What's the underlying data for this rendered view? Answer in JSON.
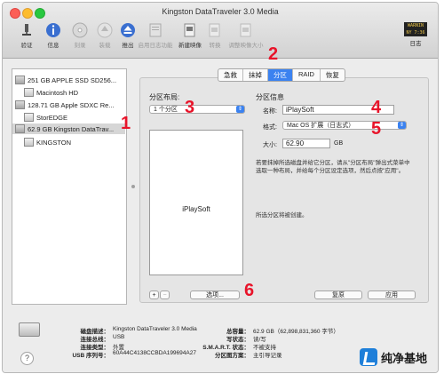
{
  "window": {
    "title": "Kingston DataTraveler 3.0 Media"
  },
  "toolbar": {
    "items": [
      {
        "label": "验证",
        "icon": "microscope-icon",
        "enabled": true
      },
      {
        "label": "信息",
        "icon": "info-icon",
        "enabled": true
      },
      {
        "label": "刻录",
        "icon": "burn-icon",
        "enabled": false
      },
      {
        "label": "装载",
        "icon": "mount-icon",
        "enabled": false
      },
      {
        "label": "推出",
        "icon": "eject-icon",
        "enabled": true
      },
      {
        "label": "启用日志功能",
        "icon": "journal-icon",
        "enabled": false
      },
      {
        "label": "新建映像",
        "icon": "new-image-icon",
        "enabled": true
      },
      {
        "label": "转换",
        "icon": "convert-icon",
        "enabled": false
      },
      {
        "label": "调整映像大小",
        "icon": "resize-image-icon",
        "enabled": false
      }
    ],
    "log": {
      "label": "日志",
      "icon_text": "WARNIN\nNY 7:36"
    }
  },
  "sidebar": {
    "items": [
      {
        "label": "251 GB APPLE SSD SD256...",
        "kind": "disk"
      },
      {
        "label": "Macintosh HD",
        "kind": "volume"
      },
      {
        "label": "128.71 GB Apple SDXC Re...",
        "kind": "disk"
      },
      {
        "label": "StorEDGE",
        "kind": "volume"
      },
      {
        "label": "62.9 GB Kingston DataTrav...",
        "kind": "disk",
        "selected": true
      },
      {
        "label": "KINGSTON",
        "kind": "volume"
      }
    ]
  },
  "tabs": [
    {
      "label": "急救"
    },
    {
      "label": "抹掉"
    },
    {
      "label": "分区",
      "active": true
    },
    {
      "label": "RAID"
    },
    {
      "label": "恢复"
    }
  ],
  "partition": {
    "layout_label": "分区布局:",
    "layout_value": "1 个分区",
    "preview_label": "iPlaySoft",
    "add_label": "+",
    "remove_label": "−",
    "options_label": "选项...",
    "info_heading": "分区信息",
    "name_label": "名称:",
    "name_value": "iPlaySoft",
    "format_label": "格式:",
    "format_value": "Mac OS 扩展（日志式）",
    "size_label": "大小:",
    "size_value": "62.90",
    "size_unit": "GB",
    "note": "若要抹掉所选磁盘并给它分区，请从\"分区布局\"弹出式菜单中选取一种布局，并给每个分区设定选项，然后点按\"应用\"。",
    "create_note": "所选分区将被创建。",
    "revert_label": "复原",
    "apply_label": "应用"
  },
  "info": {
    "left": [
      {
        "key": "磁盘描述：",
        "value": "Kingston DataTraveler 3.0 Media"
      },
      {
        "key": "连接总线：",
        "value": "USB"
      },
      {
        "key": "连接类型：",
        "value": "外置"
      },
      {
        "key": "USB 序列号：",
        "value": "60A44C4138CCBDA199694A27"
      }
    ],
    "right": [
      {
        "key": "总容量：",
        "value": "62.9 GB（62,898,831,360 字节）"
      },
      {
        "key": "写状态：",
        "value": "读/写"
      },
      {
        "key": "S.M.A.R.T. 状态：",
        "value": "不被支持"
      },
      {
        "key": "分区图方案：",
        "value": "主引导记录"
      }
    ],
    "help_label": "?"
  },
  "callouts": [
    "1",
    "2",
    "3",
    "4",
    "5",
    "6"
  ],
  "watermark": {
    "text": "纯净基地"
  }
}
